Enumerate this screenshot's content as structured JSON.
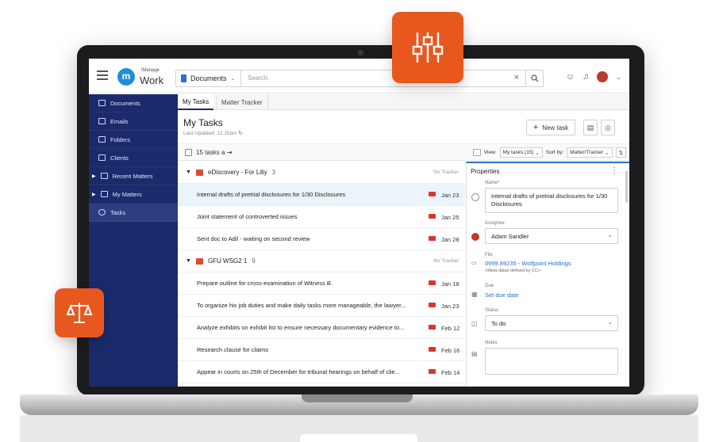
{
  "app": {
    "logo_letter": "m",
    "logo_top": "iManage",
    "logo_bottom": "Work"
  },
  "search": {
    "scope": "Documents",
    "placeholder": "Search",
    "clear": "×"
  },
  "sidebar": {
    "items": [
      {
        "label": "Documents",
        "icon": "document-icon"
      },
      {
        "label": "Emails",
        "icon": "email-icon"
      },
      {
        "label": "Folders",
        "icon": "folder-icon"
      },
      {
        "label": "Clients",
        "icon": "briefcase-icon"
      },
      {
        "label": "Recent Matters",
        "icon": "matter-icon"
      },
      {
        "label": "My Matters",
        "icon": "matter-icon"
      },
      {
        "label": "Tasks",
        "icon": "check-circle-icon"
      }
    ]
  },
  "tabs": [
    {
      "label": "My Tasks"
    },
    {
      "label": "Matter Tracker"
    }
  ],
  "main": {
    "title": "My Tasks",
    "updated": "Last Updated: 12:25pm",
    "new_task": "New task",
    "count": "15 tasks a",
    "view_label": "View:",
    "view_value": "My tasks (15)",
    "sort_label": "Sort by:",
    "sort_value": "Matter/Tracker"
  },
  "groups": [
    {
      "name": "eDiscovery - For Liliy",
      "count": "3",
      "tracker": "No Tracker",
      "tasks": [
        {
          "title": "Internal drafts of pretrial disclosures for 1/30 Disclosures",
          "due": "Jan 23"
        },
        {
          "title": "Joint statement of controverted issues",
          "due": "Jan 25"
        },
        {
          "title": "Sent doc to Adil - waiting on second review",
          "due": "Jan 28"
        }
      ]
    },
    {
      "name": "GFU WSG2 1",
      "count": "9",
      "tracker": "No Tracker",
      "tasks": [
        {
          "title": "Prepare outline for cross-examination of Witness B.",
          "due": "Jan 18"
        },
        {
          "title": "To organize his job duties and make daily tasks more manageable, the lawyer...",
          "due": "Jan 23"
        },
        {
          "title": "Analyze exhibits on exhibit list to ensure necessary documentary evidence to...",
          "due": "Feb 12"
        },
        {
          "title": "Research clause for claims",
          "due": "Feb 16"
        },
        {
          "title": "Appear in courts on 25th of December for tribunal hearings on behalf of clie...",
          "due": "Feb 14"
        }
      ]
    }
  ],
  "properties": {
    "title": "Properties",
    "name_label": "Name*",
    "name_value": "Internal drafts of pretrial disclosures for 1/30 Disclosures",
    "assignee_label": "Assignee",
    "assignee_value": "Adam Sandler",
    "file_label": "File",
    "file_value": "0999.89235 - Wolfpoint Holdings",
    "file_sub": "<Meta datas defined by CC>",
    "due_label": "Due",
    "due_value": "Set due date",
    "status_label": "Status",
    "status_value": "To do",
    "notes_label": "Notes"
  },
  "colors": {
    "accent": "#e8581e",
    "sidebar": "#1b2a6b",
    "link": "#2a6fd6"
  }
}
